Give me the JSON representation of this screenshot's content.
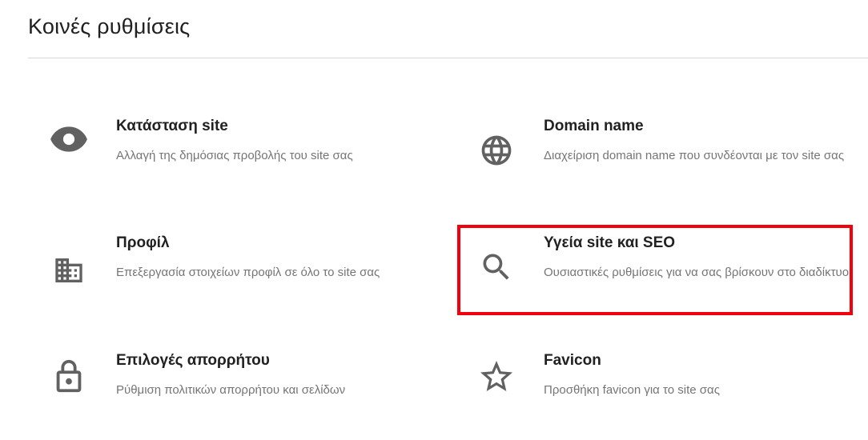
{
  "page": {
    "title": "Κοινές ρυθμίσεις"
  },
  "settings": [
    {
      "id": "site-status",
      "icon": "eye-icon",
      "title": "Κατάσταση site",
      "description": "Αλλαγή της δημόσιας προβολής του site σας"
    },
    {
      "id": "domain-name",
      "icon": "globe-icon",
      "title": "Domain name",
      "description": "Διαχείριση domain name που συνδέονται με τον site σας"
    },
    {
      "id": "profile",
      "icon": "building-icon",
      "title": "Προφίλ",
      "description": "Επεξεργασία στοιχείων προφίλ σε όλο το site σας"
    },
    {
      "id": "site-health-seo",
      "icon": "search-icon",
      "title": "Υγεία site και SEO",
      "description": "Ουσιαστικές ρυθμίσεις για να σας βρίσκουν στο διαδίκτυο",
      "highlighted": true
    },
    {
      "id": "privacy-options",
      "icon": "lock-icon",
      "title": "Επιλογές απορρήτου",
      "description": "Ρύθμιση πολιτικών απορρήτου και σελίδων"
    },
    {
      "id": "favicon",
      "icon": "star-icon",
      "title": "Favicon",
      "description": "Προσθήκη favicon για το site σας"
    }
  ],
  "colors": {
    "highlight": "#f2000b",
    "icon": "#616161",
    "title": "#212121",
    "description": "#757575"
  }
}
